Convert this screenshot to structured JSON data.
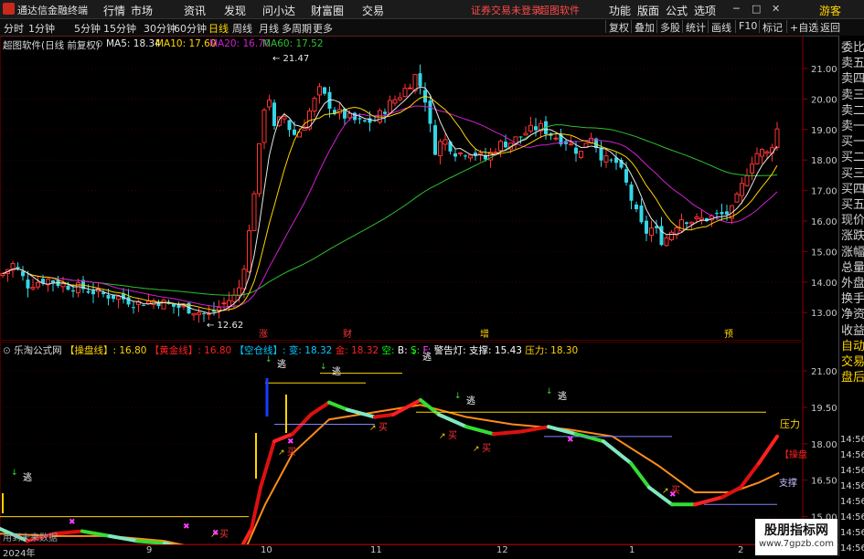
{
  "titlebar": {
    "app_title": "通达信金融终端",
    "menus": [
      "行情",
      "市场",
      "资讯",
      "发现",
      "问小达",
      "财富圈",
      "交易"
    ],
    "notice": "证券交易未登录",
    "notice2": "超图软件",
    "right_menus": [
      "功能",
      "版面",
      "公式",
      "选项"
    ],
    "guest": "游客"
  },
  "toolbar": {
    "periods": [
      "分时",
      "1分钟",
      "5分钟",
      "15分钟",
      "30分钟",
      "60分钟",
      "日线",
      "周线",
      "月线",
      "多周期",
      "更多"
    ],
    "active_period": "日线",
    "buttons": [
      "复权",
      "叠加",
      "多股",
      "统计",
      "画线",
      "F10",
      "标记",
      "+自选",
      "返回"
    ]
  },
  "main_chart": {
    "stock": "超图软件",
    "mode": "(日线 前复权)",
    "ma5_label": "MA5: 18.34",
    "ma10_label": "MA10: 17.60",
    "ma20_label": "MA20: 16.70",
    "ma60_label": "MA60: 17.52",
    "high_label": "21.47",
    "low_label": "12.62",
    "y_ticks": [
      "21.00",
      "20.00",
      "19.00",
      "18.00",
      "17.00",
      "16.00",
      "15.00",
      "14.00",
      "13.00"
    ],
    "event_markers": [
      "涨",
      "财",
      "增",
      "预"
    ],
    "colors": {
      "ma5": "#e8e8e8",
      "ma10": "#ffd400",
      "ma20": "#d020d0",
      "ma60": "#2fbf2f",
      "up": "#ff3333",
      "down": "#33d6e6"
    }
  },
  "sub_chart": {
    "source": "乐淘公式网",
    "items": [
      {
        "text": "【操盘线】: 16.80",
        "color": "#ffd400"
      },
      {
        "text": "【黄金线】: 16.80",
        "color": "#ff2020"
      },
      {
        "text": "【空仓线】: 变: 18.32",
        "color": "#00c8ff"
      },
      {
        "text": "金: 18.32",
        "color": "#ff2020"
      },
      {
        "text": "空:",
        "color": "#00ff00"
      },
      {
        "text": "B:",
        "color": "#ffffff"
      },
      {
        "text": "S:",
        "color": "#00ff00"
      },
      {
        "text": "F:",
        "color": "#ff40ff"
      },
      {
        "text": "警告灯:",
        "color": "#ffffff"
      },
      {
        "text": "支撑: 15.43",
        "color": "#ffffff"
      },
      {
        "text": "压力: 18.30",
        "color": "#ffd400"
      }
    ],
    "y_ticks": [
      "21.00",
      "19.50",
      "18.00",
      "16.50",
      "15.00"
    ],
    "escape_label": "逃",
    "buy_label": "买",
    "pressure_label": "压力",
    "operate_label": "【操盘",
    "support_label": "支撑",
    "footer_text": "用到未来数据"
  },
  "sidebar": {
    "items": [
      "委比",
      "卖五",
      "卖四",
      "卖三",
      "卖二",
      "卖一",
      "买一",
      "买二",
      "买三",
      "买四",
      "买五",
      "现价",
      "涨跌",
      "涨幅",
      "总量",
      "外盘",
      "换手",
      "净资",
      "收益",
      "自动",
      "交易",
      "盘后"
    ],
    "times": [
      "14:56",
      "14:56",
      "14:56",
      "14:56",
      "14:56",
      "14:56",
      "14:56",
      "14:56"
    ]
  },
  "bottom_axis": {
    "dates": [
      "2024年",
      "9",
      "10",
      "11",
      "12",
      "1",
      "2"
    ]
  },
  "watermark": {
    "line1": "股朋指标网",
    "line2": "www.7gpzb.com"
  }
}
